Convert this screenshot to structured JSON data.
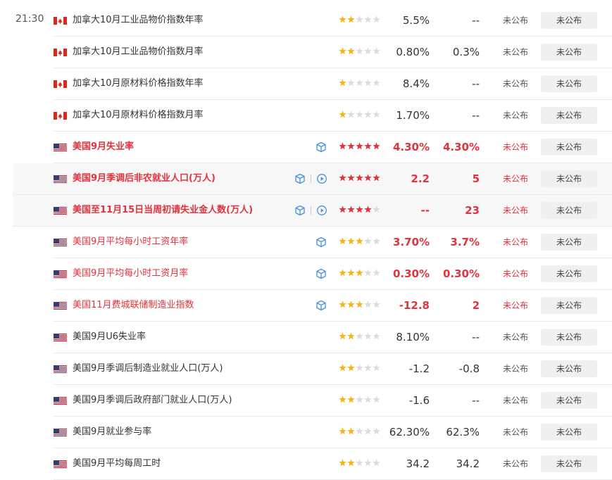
{
  "calendar": {
    "time": "21:30",
    "colors": {
      "star_on": "#f2b619",
      "star_off": "#dcdcdc",
      "star_red": "#e0333d",
      "accent_red": "#e0333d",
      "icon_blue": "#4a8fe0"
    },
    "rows": [
      {
        "flag": "canada-flag",
        "title": "加拿大10月工业品物价指数年率",
        "stars": 2,
        "previous": "5.5%",
        "forecast": "--",
        "actual": "未公布",
        "status": "未公布",
        "style": "normal",
        "cube": false,
        "play": false
      },
      {
        "flag": "canada-flag",
        "title": "加拿大10月工业品物价指数月率",
        "stars": 2,
        "previous": "0.80%",
        "forecast": "0.3%",
        "actual": "未公布",
        "status": "未公布",
        "style": "normal",
        "cube": false,
        "play": false
      },
      {
        "flag": "canada-flag",
        "title": "加拿大10月原材料价格指数年率",
        "stars": 1,
        "previous": "8.4%",
        "forecast": "--",
        "actual": "未公布",
        "status": "未公布",
        "style": "normal",
        "cube": false,
        "play": false
      },
      {
        "flag": "canada-flag",
        "title": "加拿大10月原材料价格指数月率",
        "stars": 1,
        "previous": "1.70%",
        "forecast": "--",
        "actual": "未公布",
        "status": "未公布",
        "style": "normal",
        "cube": false,
        "play": false
      },
      {
        "flag": "us-flag",
        "title": "美国9月失业率",
        "stars": 5,
        "previous": "4.30%",
        "forecast": "4.30%",
        "actual": "未公布",
        "status": "未公布",
        "style": "important",
        "cube": true,
        "play": false
      },
      {
        "flag": "us-flag",
        "title": "美国9月季调后非农就业人口(万人)",
        "stars": 5,
        "previous": "2.2",
        "forecast": "5",
        "actual": "未公布",
        "status": "未公布",
        "style": "important-hl",
        "cube": true,
        "play": true
      },
      {
        "flag": "us-flag",
        "title": "美国至11月15日当周初请失业金人数(万人)",
        "stars": 4,
        "previous": "--",
        "forecast": "23",
        "actual": "未公布",
        "status": "未公布",
        "style": "important-hl",
        "cube": true,
        "play": true
      },
      {
        "flag": "us-flag",
        "title": "美国9月平均每小时工资年率",
        "stars": 3,
        "previous": "3.70%",
        "forecast": "3.7%",
        "actual": "未公布",
        "status": "未公布",
        "style": "red",
        "cube": true,
        "play": false
      },
      {
        "flag": "us-flag",
        "title": "美国9月平均每小时工资月率",
        "stars": 3,
        "previous": "0.30%",
        "forecast": "0.30%",
        "actual": "未公布",
        "status": "未公布",
        "style": "red",
        "cube": true,
        "play": false
      },
      {
        "flag": "us-flag",
        "title": "美国11月费城联储制造业指数",
        "stars": 3,
        "previous": "-12.8",
        "forecast": "2",
        "actual": "未公布",
        "status": "未公布",
        "style": "red",
        "cube": true,
        "play": false
      },
      {
        "flag": "us-flag",
        "title": "美国9月U6失业率",
        "stars": 2,
        "previous": "8.10%",
        "forecast": "--",
        "actual": "未公布",
        "status": "未公布",
        "style": "normal",
        "cube": false,
        "play": false
      },
      {
        "flag": "us-flag",
        "title": "美国9月季调后制造业就业人口(万人)",
        "stars": 2,
        "previous": "-1.2",
        "forecast": "-0.8",
        "actual": "未公布",
        "status": "未公布",
        "style": "normal",
        "cube": false,
        "play": false
      },
      {
        "flag": "us-flag",
        "title": "美国9月季调后政府部门就业人口(万人)",
        "stars": 2,
        "previous": "-1.6",
        "forecast": "--",
        "actual": "未公布",
        "status": "未公布",
        "style": "normal",
        "cube": false,
        "play": false
      },
      {
        "flag": "us-flag",
        "title": "美国9月就业参与率",
        "stars": 2,
        "previous": "62.30%",
        "forecast": "62.3%",
        "actual": "未公布",
        "status": "未公布",
        "style": "normal",
        "cube": false,
        "play": false
      },
      {
        "flag": "us-flag",
        "title": "美国9月平均每周工时",
        "stars": 2,
        "previous": "34.2",
        "forecast": "34.2",
        "actual": "未公布",
        "status": "未公布",
        "style": "normal",
        "cube": false,
        "play": false
      }
    ]
  }
}
